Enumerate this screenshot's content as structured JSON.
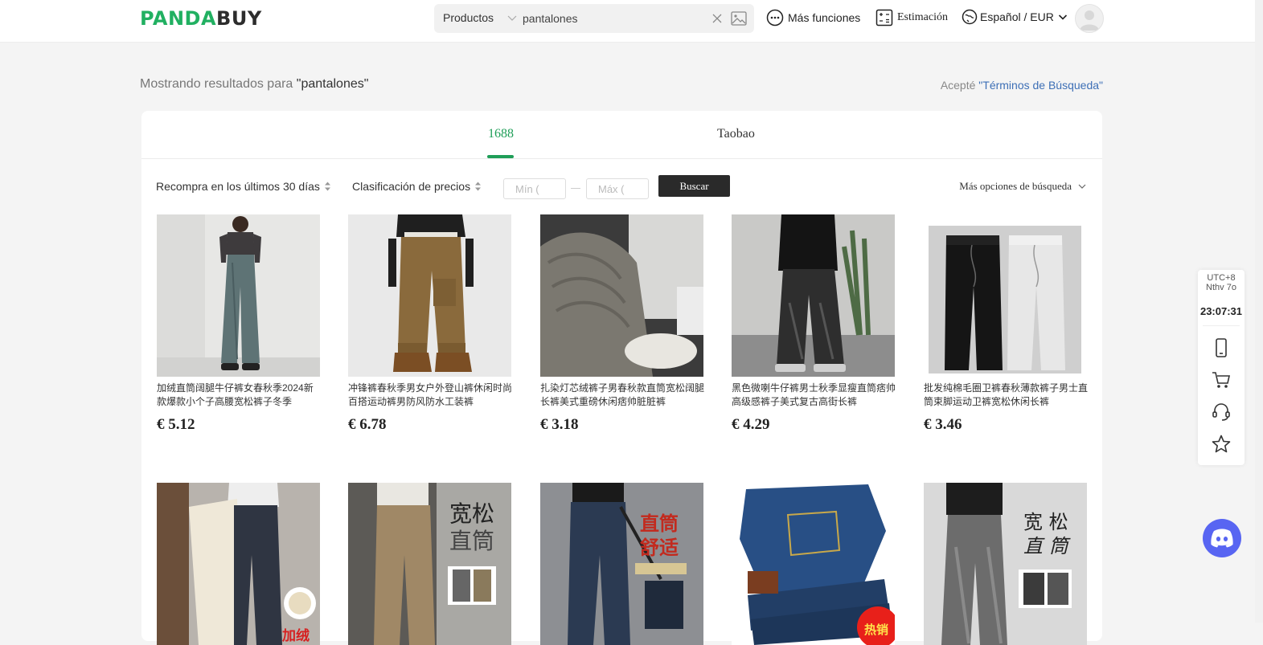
{
  "header": {
    "logo_green": "PANDA",
    "logo_dark": "BUY",
    "search_category": "Productos",
    "search_value": "pantalones",
    "more_functions": "Más funciones",
    "estimation": "Estimación",
    "language_currency": "Español / EUR"
  },
  "results": {
    "prefix": "Mostrando resultados para ",
    "query": "\"pantalones\"",
    "terms_prefix": "Acepté ",
    "terms_link": "\"Términos de Búsqueda\""
  },
  "tabs": [
    {
      "label": "1688",
      "active": true
    },
    {
      "label": "Taobao",
      "active": false
    }
  ],
  "filters": {
    "repurchase": "Recompra en los últimos 30 días",
    "price_sort": "Clasificación de precios",
    "min_placeholder": "Mín (",
    "max_placeholder": "Máx (",
    "search_button": "Buscar",
    "more_options": "Más opciones de búsqueda"
  },
  "products": [
    {
      "title": "加绒直筒阔腿牛仔裤女春秋季2024新款爆款小个子高腰宽松裤子冬季",
      "price": "€ 5.12"
    },
    {
      "title": "冲锋裤春秋季男女户外登山裤休闲时尚百搭运动裤男防风防水工装裤",
      "price": "€ 6.78"
    },
    {
      "title": "扎染灯芯绒裤子男春秋款直筒宽松阔腿长裤美式重磅休闲痞帅脏脏裤",
      "price": "€ 3.18"
    },
    {
      "title": "黑色微喇牛仔裤男士秋季显瘦直筒痞帅高级感裤子美式复古高街长裤",
      "price": "€ 4.29"
    },
    {
      "title": "批发纯棉毛圈卫裤春秋薄款裤子男士直筒束脚运动卫裤宽松休闲长裤",
      "price": "€ 3.46"
    }
  ],
  "row2_badges": {
    "p1": "加绒",
    "p2_line1": "宽松",
    "p2_line2": "直筒",
    "p3_line1": "直筒",
    "p3_line2": "舒适",
    "p4": "热销",
    "p5_line1": "宽 松",
    "p5_line2": "直 筒"
  },
  "side": {
    "tz_line1": "UTC+8",
    "tz_line2": "Nthv 7o",
    "time": "23:07:31"
  }
}
